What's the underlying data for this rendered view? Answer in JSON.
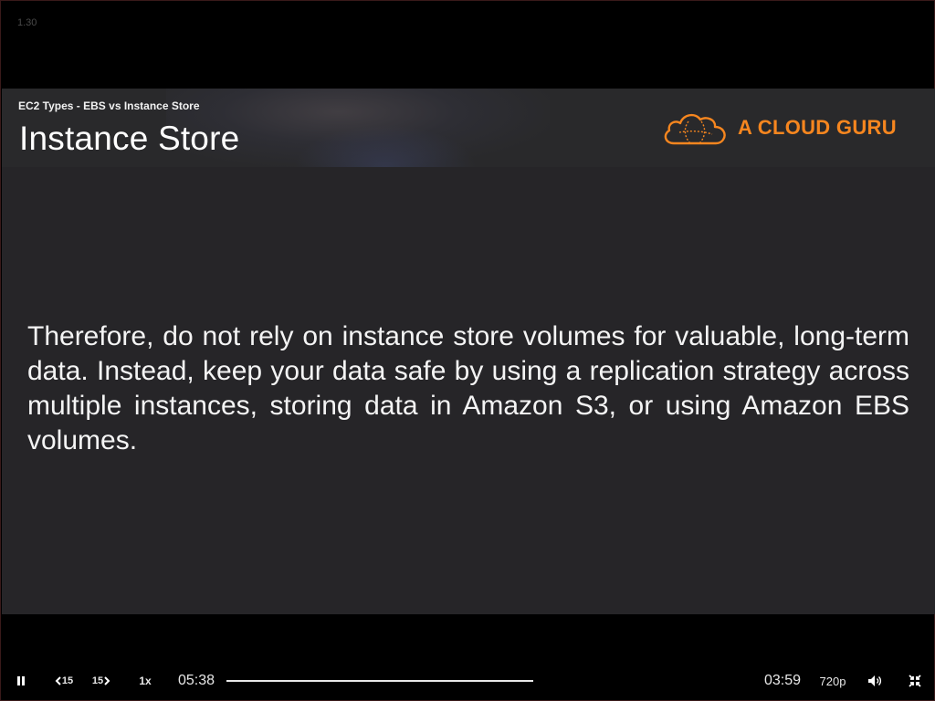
{
  "player": {
    "version": "1.30"
  },
  "slide": {
    "subtitle": "EC2 Types - EBS vs Instance Store",
    "title": "Instance Store",
    "logo_text": "A CLOUD GURU",
    "body": "Therefore, do not rely on instance store volumes for valuable, long-term data. Instead, keep your data safe by using a replication strategy across multiple instances, storing data in Amazon S3, or using Amazon EBS volumes."
  },
  "controls": {
    "pause_icon": "pause-icon",
    "rewind_label": "15",
    "forward_label": "15",
    "speed_label": "1x",
    "elapsed_time": "05:38",
    "remaining_time": "03:59",
    "progress": 1.0,
    "quality_label": "720p",
    "volume_icon": "volume-icon",
    "fullscreen_icon": "exit-fullscreen-icon"
  },
  "colors": {
    "brand_orange": "#f6861f",
    "slide_background": "#262528",
    "player_background": "#000000"
  }
}
